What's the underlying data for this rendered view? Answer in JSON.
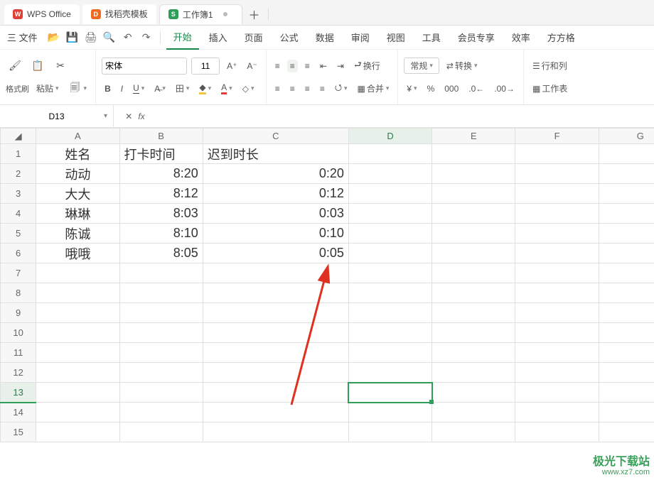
{
  "titlebar": {
    "homeTab": "WPS Office",
    "templateTab": "找稻壳模板",
    "docBadge": "S",
    "docTitle": "工作簿1"
  },
  "menubar": {
    "file": "三 文件",
    "tabs": [
      "开始",
      "插入",
      "页面",
      "公式",
      "数据",
      "审阅",
      "视图",
      "工具",
      "会员专享",
      "效率",
      "方方格"
    ]
  },
  "ribbon": {
    "formatPainter": "格式刷",
    "paste": "粘贴",
    "fontName": "宋体",
    "fontSize": "11",
    "wrap": "换行",
    "merge": "合并",
    "numfmt": "常规",
    "convert": "转换",
    "rowcol": "行和列",
    "sheet": "工作表"
  },
  "fx": {
    "cellRef": "D13",
    "formula": ""
  },
  "columns": [
    "A",
    "B",
    "C",
    "D",
    "E",
    "F",
    "G"
  ],
  "rows": [
    "1",
    "2",
    "3",
    "4",
    "5",
    "6",
    "7",
    "8",
    "9",
    "10",
    "11",
    "12",
    "13",
    "14",
    "15"
  ],
  "chart_data": {
    "type": "table",
    "headers": [
      "姓名",
      "打卡时间",
      "迟到时长"
    ],
    "data": [
      [
        "动动",
        "8:20",
        "0:20"
      ],
      [
        "大大",
        "8:12",
        "0:12"
      ],
      [
        "琳琳",
        "8:03",
        "0:03"
      ],
      [
        "陈诚",
        "8:10",
        "0:10"
      ],
      [
        "哦哦",
        "8:05",
        "0:05"
      ]
    ]
  },
  "watermark": {
    "brand": "极光下载站",
    "url": "www.xz7.com"
  }
}
